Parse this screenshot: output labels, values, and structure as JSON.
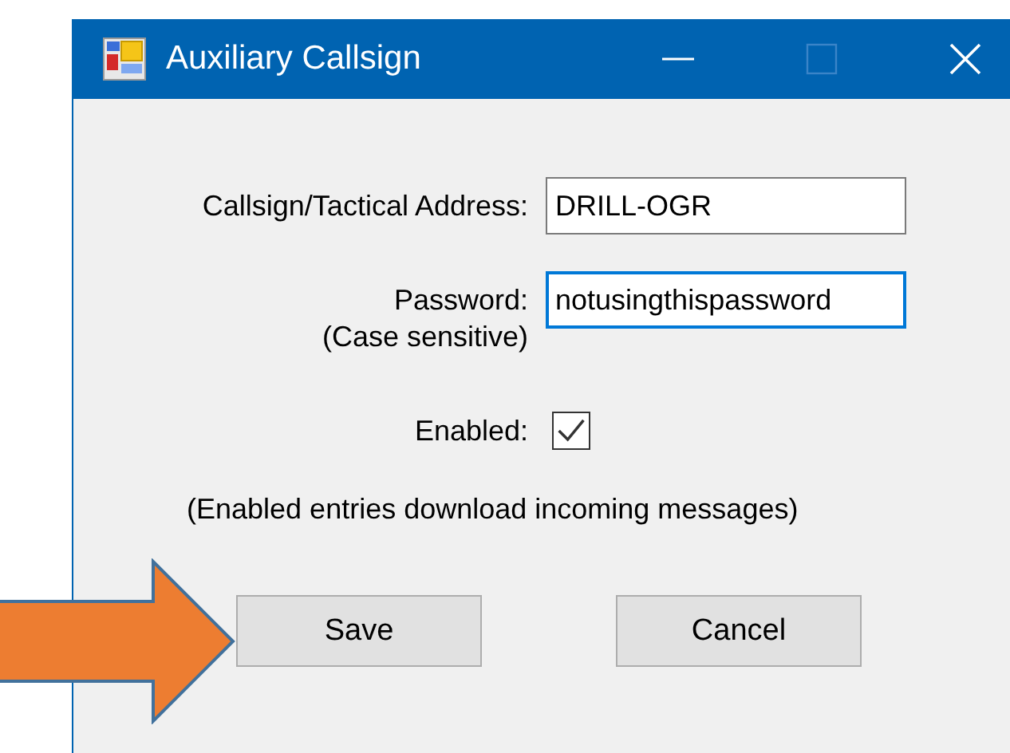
{
  "window": {
    "title": "Auxiliary Callsign",
    "maximize_enabled": false
  },
  "fields": [
    {
      "label": "Callsign/Tactical Address:",
      "value": "DRILL-OGR",
      "focused": false
    },
    {
      "label": "Password:",
      "sublabel": "(Case sensitive)",
      "value": "notusingthispassword",
      "focused": true
    }
  ],
  "enabled": {
    "label": "Enabled:",
    "checked": true
  },
  "note": "(Enabled entries download incoming messages)",
  "buttons": [
    "Save",
    "Cancel"
  ]
}
